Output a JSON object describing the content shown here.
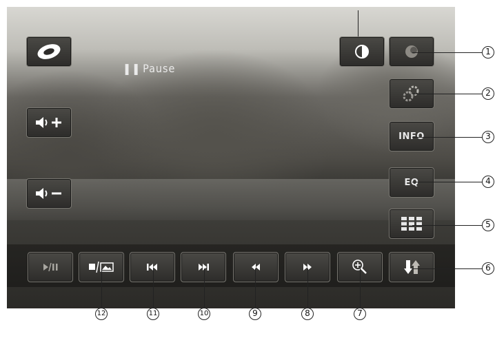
{
  "status": {
    "pause_label": "Pause"
  },
  "left_buttons": [
    {
      "id": "source",
      "icon": "ring-icon"
    },
    {
      "id": "volume-up",
      "icon": "volume-up-icon"
    },
    {
      "id": "volume-down",
      "icon": "volume-down-icon"
    }
  ],
  "right_buttons": {
    "brightness": {
      "icon": "contrast-icon"
    },
    "color": {
      "icon": "color-icon"
    },
    "settings": {
      "icon": "gear-icon"
    },
    "info": {
      "label": "INFO"
    },
    "eq": {
      "label": "EQ"
    },
    "keypad": {
      "icon": "keypad-icon"
    },
    "angle": {
      "icon": "up-down-arrows-icon"
    }
  },
  "bottom_buttons": [
    {
      "id": "play-pause",
      "icon": "play-pause-icon"
    },
    {
      "id": "pip",
      "icon": "stop-picture-icon"
    },
    {
      "id": "previous",
      "icon": "previous-track-icon"
    },
    {
      "id": "next",
      "icon": "next-track-icon"
    },
    {
      "id": "rewind",
      "icon": "rewind-icon"
    },
    {
      "id": "fast-forward",
      "icon": "fast-forward-icon"
    },
    {
      "id": "zoom",
      "icon": "zoom-icon"
    }
  ],
  "callouts": {
    "c1": "1",
    "c2": "2",
    "c3": "3",
    "c4": "4",
    "c5": "5",
    "c6": "6",
    "c7": "7",
    "c8": "8",
    "c9": "9",
    "c10": "10",
    "c11": "11",
    "c12": "12"
  }
}
